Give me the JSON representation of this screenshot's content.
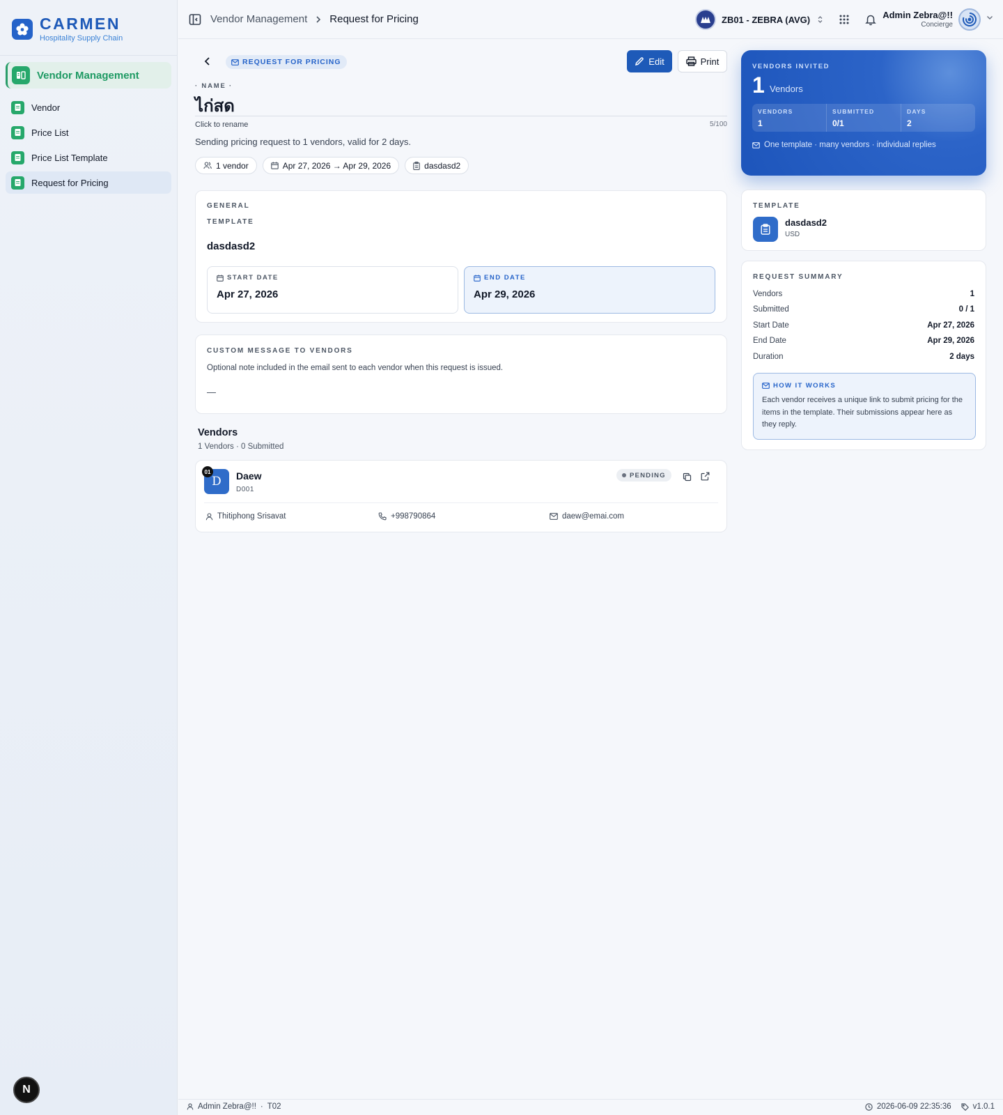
{
  "brand": {
    "name": "CARMEN",
    "subtitle": "Hospitality Supply Chain"
  },
  "sidebar": {
    "module": "Vendor Management",
    "items": [
      {
        "label": "Vendor"
      },
      {
        "label": "Price List"
      },
      {
        "label": "Price List Template"
      },
      {
        "label": "Request for Pricing",
        "active": true
      }
    ],
    "dev_badge": "N"
  },
  "topbar": {
    "breadcrumb": [
      "Vendor Management",
      "Request for Pricing"
    ],
    "tenant": "ZB01 - ZEBRA (AVG)",
    "user_name": "Admin Zebra@!!",
    "user_role": "Concierge"
  },
  "header": {
    "kind_badge": "REQUEST FOR PRICING",
    "edit_label": "Edit",
    "print_label": "Print",
    "name_label": "NAME",
    "name_value": "ไก่สด",
    "rename_hint": "Click to rename",
    "char_count": "5/100",
    "summary": "Sending pricing request to 1 vendors, valid for 2 days.",
    "chips": {
      "vendors": "1 vendor",
      "dates": "Apr 27, 2026 → Apr 29, 2026",
      "template": "dasdasd2"
    }
  },
  "general": {
    "section_label": "GENERAL",
    "template_label": "TEMPLATE",
    "template_value": "dasdasd2",
    "start_label": "START DATE",
    "start_value": "Apr 27, 2026",
    "end_label": "END DATE",
    "end_value": "Apr 29, 2026"
  },
  "message": {
    "label": "CUSTOM MESSAGE TO VENDORS",
    "hint": "Optional note included in the email sent to each vendor when this request is issued.",
    "value": "—"
  },
  "vendors": {
    "title": "Vendors",
    "subtitle": "1 Vendors · 0 Submitted",
    "list": [
      {
        "index": "01",
        "initial": "D",
        "name": "Daew",
        "code": "D001",
        "status": "PENDING",
        "contact": "Thitiphong Srisavat",
        "phone": "+998790864",
        "email": "daew@emai.com"
      }
    ]
  },
  "hero": {
    "label": "VENDORS INVITED",
    "count": "1",
    "unit": "Vendors",
    "stats": [
      {
        "label": "VENDORS",
        "value": "1"
      },
      {
        "label": "SUBMITTED",
        "value": "0/1"
      },
      {
        "label": "DAYS",
        "value": "2"
      }
    ],
    "footnote": "One template · many vendors · individual replies"
  },
  "template_card": {
    "label": "TEMPLATE",
    "name": "dasdasd2",
    "currency": "USD"
  },
  "request_summary": {
    "label": "REQUEST SUMMARY",
    "rows": [
      {
        "key": "Vendors",
        "value": "1"
      },
      {
        "key": "Submitted",
        "value": "0 / 1"
      },
      {
        "key": "Start Date",
        "value": "Apr 27, 2026"
      },
      {
        "key": "End Date",
        "value": "Apr 29, 2026"
      },
      {
        "key": "Duration",
        "value": "2 days"
      }
    ],
    "how_label": "HOW IT WORKS",
    "how_text": "Each vendor receives a unique link to submit pricing for the items in the template. Their submissions appear here as they reply."
  },
  "footer": {
    "user": "Admin Zebra@!!",
    "separator": "·",
    "code": "T02",
    "timestamp": "2026-06-09 22:35:36",
    "version": "v1.0.1"
  },
  "colors": {
    "primary": "#1e5ab8",
    "accent_green": "#26a86b",
    "end_highlight": "#edf3fc"
  }
}
